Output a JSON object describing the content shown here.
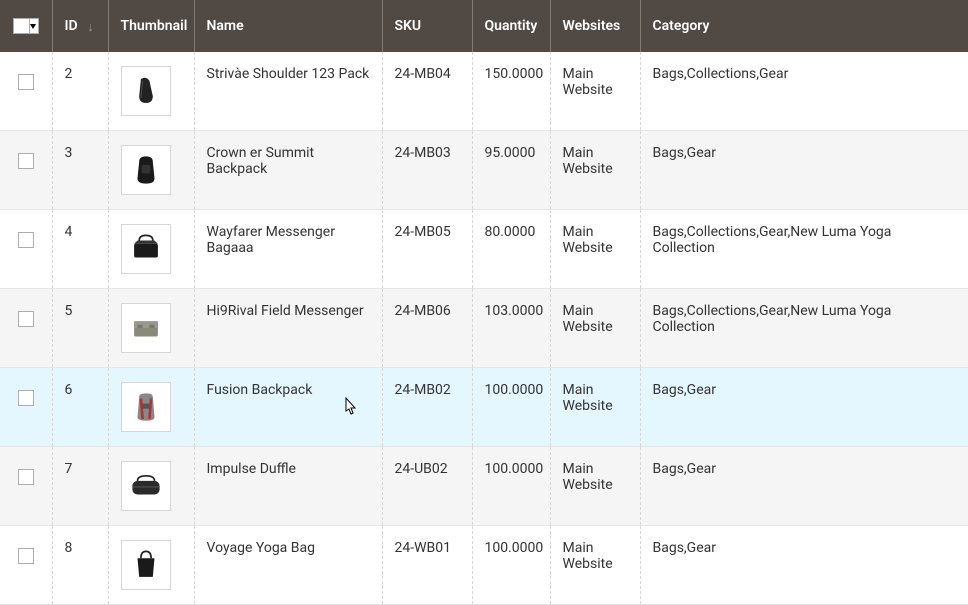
{
  "columns": {
    "id": "ID",
    "thumbnail": "Thumbnail",
    "name": "Name",
    "sku": "SKU",
    "quantity": "Quantity",
    "websites": "Websites",
    "category": "Category"
  },
  "rows": [
    {
      "id": "2",
      "name": "Strivàe Shoulder 123 Pack",
      "sku": "24-MB04",
      "qty": "150.0000",
      "web": "Main Website",
      "cat": "Bags,Collections,Gear",
      "icon": "sling"
    },
    {
      "id": "3",
      "name": "Crown er Summit Backpack",
      "sku": "24-MB03",
      "qty": "95.0000",
      "web": "Main Website",
      "cat": "Bags,Gear",
      "icon": "backpack"
    },
    {
      "id": "4",
      "name": "Wayfarer Messenger Bagaaa",
      "sku": "24-MB05",
      "qty": "80.0000",
      "web": "Main Website",
      "cat": "Bags,Collections,Gear,New Luma Yoga Collection",
      "icon": "messenger"
    },
    {
      "id": "5",
      "name": "Hi9Rival Field Messenger",
      "sku": "24-MB06",
      "qty": "103.0000",
      "web": "Main Website",
      "cat": "Bags,Collections,Gear,New Luma Yoga Collection",
      "icon": "field"
    },
    {
      "id": "6",
      "name": "Fusion Backpack",
      "sku": "24-MB02",
      "qty": "100.0000",
      "web": "Main Website",
      "cat": "Bags,Gear",
      "icon": "fusion"
    },
    {
      "id": "7",
      "name": "Impulse Duffle",
      "sku": "24-UB02",
      "qty": "100.0000",
      "web": "Main Website",
      "cat": "Bags,Gear",
      "icon": "duffle"
    },
    {
      "id": "8",
      "name": "Voyage Yoga Bag",
      "sku": "24-WB01",
      "qty": "100.0000",
      "web": "Main Website",
      "cat": "Bags,Gear",
      "icon": "tote"
    }
  ]
}
